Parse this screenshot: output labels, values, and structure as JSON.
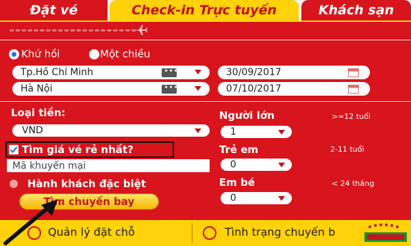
{
  "tabs": [
    {
      "label": "Đặt vé"
    },
    {
      "label": "Check-in Trực tuyến"
    },
    {
      "label": "Khách sạn"
    }
  ],
  "trip_type": {
    "round_trip": "Khứ hồi",
    "one_way": "Một chiều",
    "selected": "round_trip"
  },
  "route": {
    "origin": "Tp.Hồ Chí Minh",
    "destination": "Hà Nội",
    "depart_date": "30/09/2017",
    "return_date": "07/10/2017"
  },
  "currency": {
    "label": "Loại tiền:",
    "value": "VND"
  },
  "passengers": {
    "adults": {
      "label": "Người lớn",
      "hint": ">=12 tuổi",
      "value": "1"
    },
    "children": {
      "label": "Trẻ em",
      "hint": "2-11 tuổi",
      "value": "0"
    },
    "infants": {
      "label": "Em bé",
      "hint": "< 24 tháng",
      "value": "0"
    }
  },
  "cheapest_fare": {
    "label": "Tìm giá vé rẻ nhất?",
    "checked": true
  },
  "promo": {
    "placeholder": "Mã khuyến mại"
  },
  "special_passenger": {
    "label": "Hành khách đặc biệt"
  },
  "search_button": {
    "label": "Tìm chuyến bay"
  },
  "bottom": {
    "manage": "Quản lý đặt chỗ",
    "status": "Tình trạng chuyến b"
  },
  "colors": {
    "primary_red": "#d8141c",
    "accent_yellow": "#ffd20a",
    "radio_blue": "#2a6fd6"
  },
  "icons": [
    "plane-icon",
    "calendar-icon",
    "dots-icon",
    "chevron-down-icon",
    "globe-icon",
    "arrow-icon"
  ]
}
